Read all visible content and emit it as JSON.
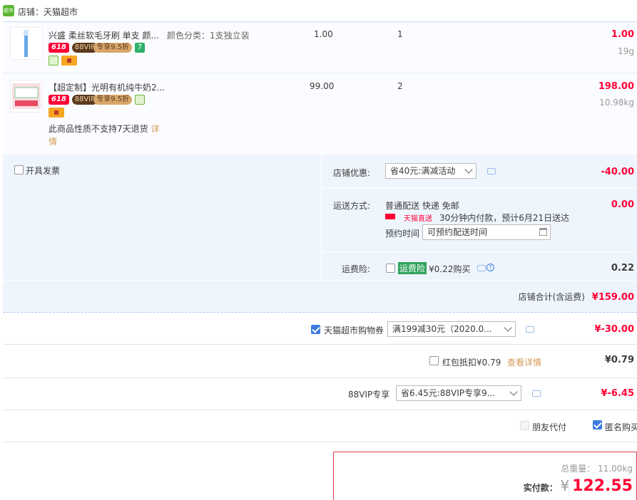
{
  "shop": {
    "label": "店铺：天猫超市",
    "icon": "tmall-supermarket-icon"
  },
  "items": [
    {
      "title": "兴盛 柔丝软毛牙刷 单支 颜...",
      "sku": "颜色分类：1支独立装",
      "price": "1.00",
      "qty": "1",
      "subtotal": "1.00",
      "weight": "19g",
      "badge_618": "618",
      "badge_vip": "88VIP",
      "badge_vip_discount": "专享9.5折",
      "badge_7": "7"
    },
    {
      "title": "【超定制】光明有机纯牛奶2...",
      "price": "99.00",
      "qty": "2",
      "subtotal": "198.00",
      "weight": "10.98kg",
      "badge_618": "618",
      "badge_vip": "88VIP",
      "badge_vip_discount": "专享9.5折",
      "notice": "此商品性质不支持7天退货",
      "notice_link": "详情"
    }
  ],
  "invoice": {
    "label": "开具发票"
  },
  "shop_discount": {
    "label": "店铺优惠:",
    "selected": "省40元:满减活动",
    "amount": "-40.00"
  },
  "shipping": {
    "label": "运送方式:",
    "method": "普通配送 快递 免邮",
    "brand": "天猫直送",
    "promise": "30分钟内付款，预计6月21日送达",
    "reserve_label": "预约时间",
    "reserve_placeholder": "可预约配送时间",
    "amount": "0.00"
  },
  "insurance": {
    "label": "运费险:",
    "tag": "运费险",
    "text": "¥0.22购买",
    "amount": "0.22"
  },
  "shop_total": {
    "label": "店铺合计(含运费)",
    "amount": "¥159.00"
  },
  "coupon": {
    "label": "天猫超市购物券",
    "selected": "满199减30元（2020.0...",
    "amount": "¥-30.00",
    "checked": true
  },
  "redpacket": {
    "label": "红包抵扣¥0.79",
    "link": "查看详情",
    "amount": "¥0.79",
    "checked": false
  },
  "vip": {
    "label": "88VIP专享",
    "selected": "省6.45元:88VIP专享9...",
    "amount": "¥-6.45"
  },
  "friend_pay": {
    "label": "朋友代付"
  },
  "anonymous": {
    "label": "匿名购买"
  },
  "summary": {
    "weight_label": "总重量：",
    "weight": "11.00kg",
    "pay_label": "实付款：",
    "currency": "¥",
    "pay_amount": "122.55"
  },
  "colors": {
    "accent": "#ff0036",
    "blue_bg": "#eef5fd",
    "tmall_green": "#5cb531"
  }
}
